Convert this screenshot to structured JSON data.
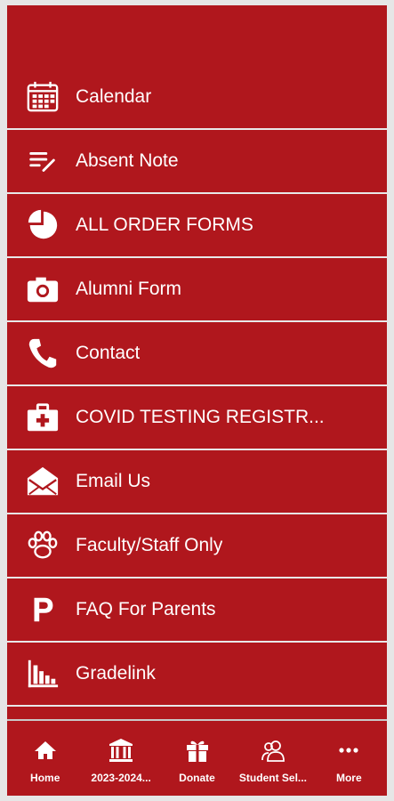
{
  "menu": {
    "items": [
      {
        "label": "Calendar",
        "icon": "calendar-icon"
      },
      {
        "label": "Absent Note",
        "icon": "note-edit-icon"
      },
      {
        "label": "ALL ORDER FORMS",
        "icon": "pie-chart-icon"
      },
      {
        "label": "Alumni Form",
        "icon": "camera-icon"
      },
      {
        "label": "Contact",
        "icon": "phone-icon"
      },
      {
        "label": "COVID TESTING REGISTR...",
        "icon": "medical-kit-icon"
      },
      {
        "label": "Email Us",
        "icon": "envelope-icon"
      },
      {
        "label": "Faculty/Staff Only",
        "icon": "paw-icon"
      },
      {
        "label": "FAQ For Parents",
        "icon": "parking-icon"
      },
      {
        "label": "Gradelink",
        "icon": "bar-chart-icon"
      }
    ]
  },
  "tabbar": {
    "tabs": [
      {
        "label": "Home",
        "icon": "home-icon"
      },
      {
        "label": "2023-2024...",
        "icon": "bank-building-icon"
      },
      {
        "label": "Donate",
        "icon": "gift-icon"
      },
      {
        "label": "Student Sel...",
        "icon": "users-icon"
      },
      {
        "label": "More",
        "icon": "more-dots-icon"
      }
    ]
  },
  "colors": {
    "primary": "#b0171d",
    "text": "#ffffff",
    "divider": "#e8e8e8"
  }
}
